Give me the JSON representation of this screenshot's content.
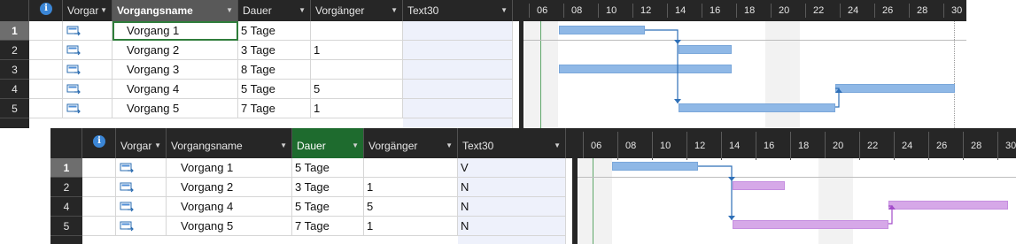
{
  "top_view": {
    "headers": {
      "type": "Vorgar",
      "name": "Vorgangsname",
      "duration": "Dauer",
      "predecessors": "Vorgänger",
      "text30": "Text30"
    },
    "rows": [
      {
        "id": "1",
        "name": "Vorgang 1",
        "duration": "5 Tage",
        "pred": ""
      },
      {
        "id": "2",
        "name": "Vorgang 2",
        "duration": "3 Tage",
        "pred": "1"
      },
      {
        "id": "3",
        "name": "Vorgang 3",
        "duration": "8 Tage",
        "pred": ""
      },
      {
        "id": "4",
        "name": "Vorgang 4",
        "duration": "5 Tage",
        "pred": "5"
      },
      {
        "id": "5",
        "name": "Vorgang 5",
        "duration": "7 Tage",
        "pred": "1"
      }
    ],
    "timescale": [
      "06",
      "08",
      "10",
      "12",
      "14",
      "16",
      "18",
      "20",
      "22",
      "24",
      "26",
      "28",
      "30"
    ]
  },
  "bottom_view": {
    "headers": {
      "type": "Vorgar",
      "name": "Vorgangsname",
      "duration": "Dauer",
      "predecessors": "Vorgänger",
      "text30": "Text30"
    },
    "rows": [
      {
        "id": "1",
        "name": "Vorgang 1",
        "duration": "5 Tage",
        "pred": "",
        "text30": "V"
      },
      {
        "id": "2",
        "name": "Vorgang 2",
        "duration": "3 Tage",
        "pred": "1",
        "text30": "N"
      },
      {
        "id": "4",
        "name": "Vorgang 4",
        "duration": "5 Tage",
        "pred": "5",
        "text30": "N"
      },
      {
        "id": "5",
        "name": "Vorgang 5",
        "duration": "7 Tage",
        "pred": "1",
        "text30": "N"
      }
    ],
    "timescale": [
      "06",
      "08",
      "10",
      "12",
      "14",
      "16",
      "18",
      "20",
      "22",
      "24",
      "26",
      "28",
      "30"
    ]
  },
  "icons": {
    "info": "info-icon",
    "task_mode": "auto-scheduled-task-icon",
    "dropdown": "dropdown-arrow-icon"
  },
  "colors": {
    "header_bg": "#262626",
    "bar_normal": "#8fb8e6",
    "bar_critical": "#d6a8e8",
    "text30_bg": "#eef1fb",
    "selected_column": "#1e6b2e"
  }
}
